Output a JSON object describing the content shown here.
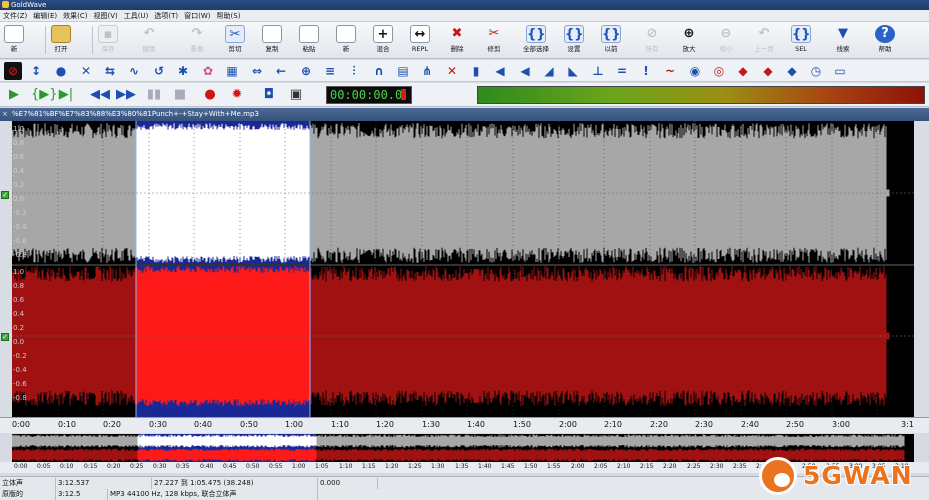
{
  "window": {
    "title": "GoldWave"
  },
  "menu": [
    "文件(Z)",
    "编辑(E)",
    "效果(C)",
    "视图(V)",
    "工具(U)",
    "选项(T)",
    "窗口(W)",
    "帮助(S)"
  ],
  "toolbar_main": [
    {
      "label": "新",
      "icon": "new-file-icon",
      "enabled": true
    },
    {
      "label": "打开",
      "icon": "folder-open-icon",
      "enabled": true
    },
    {
      "label": "保存",
      "icon": "save-icon",
      "enabled": false
    },
    {
      "label": "撤销",
      "icon": "undo-icon",
      "enabled": false
    },
    {
      "label": "重做",
      "icon": "redo-icon",
      "enabled": false
    },
    {
      "label": "剪切",
      "icon": "scissors-icon",
      "enabled": true
    },
    {
      "label": "复制",
      "icon": "copy-icon",
      "enabled": true
    },
    {
      "label": "粘贴",
      "icon": "paste-icon",
      "enabled": true
    },
    {
      "label": "新",
      "icon": "paste-new-icon",
      "enabled": true
    },
    {
      "label": "混合",
      "icon": "mix-icon",
      "enabled": true
    },
    {
      "label": "REPL",
      "icon": "replace-icon",
      "enabled": true
    },
    {
      "label": "删除",
      "icon": "delete-icon",
      "enabled": true
    },
    {
      "label": "修剪",
      "icon": "trim-icon",
      "enabled": true
    },
    {
      "label": "全部选择",
      "icon": "select-all-icon",
      "enabled": true
    },
    {
      "label": "设置",
      "icon": "set-marker-icon",
      "enabled": true
    },
    {
      "label": "以前",
      "icon": "previous-icon",
      "enabled": true
    },
    {
      "label": "所有",
      "icon": "zoom-all-icon",
      "enabled": false
    },
    {
      "label": "放大",
      "icon": "zoom-in-icon",
      "enabled": true
    },
    {
      "label": "缩小",
      "icon": "zoom-out-icon",
      "enabled": false
    },
    {
      "label": "上一页",
      "icon": "previous-page-icon",
      "enabled": false
    },
    {
      "label": "SEL",
      "icon": "zoom-selection-icon",
      "enabled": true
    },
    {
      "label": "线索",
      "icon": "cue-icon",
      "enabled": true
    },
    {
      "label": "帮助",
      "icon": "help-icon",
      "enabled": true
    }
  ],
  "transport": {
    "time": "00:00:00.0"
  },
  "file": {
    "name": "%E7%81%BF%E7%83%88%E3%80%81Punch+-+Stay+With+Me.mp3"
  },
  "amplitude_labels": [
    "1.0",
    "0.8",
    "0.6",
    "0.4",
    "0.2",
    "0.0",
    "-0.2",
    "-0.4",
    "-0.6",
    "-0.8"
  ],
  "time_ticks": [
    "0:00",
    "0:10",
    "0:20",
    "0:30",
    "0:40",
    "0:50",
    "1:00",
    "1:10",
    "1:20",
    "1:30",
    "1:40",
    "1:50",
    "2:00",
    "2:10",
    "2:20",
    "2:30",
    "2:40",
    "2:50",
    "3:00",
    "3:1"
  ],
  "overview_ticks": [
    "0:00",
    "0:05",
    "0:10",
    "0:15",
    "0:20",
    "0:25",
    "0:30",
    "0:35",
    "0:40",
    "0:45",
    "0:50",
    "0:55",
    "1:00",
    "1:05",
    "1:10",
    "1:15",
    "1:20",
    "1:25",
    "1:30",
    "1:35",
    "1:40",
    "1:45",
    "1:50",
    "1:55",
    "2:00",
    "2:05",
    "2:10",
    "2:15",
    "2:20",
    "2:25",
    "2:30",
    "2:35",
    "2:40",
    "2:45",
    "2:50",
    "2:55",
    "3:00",
    "3:05",
    "3:10"
  ],
  "selection": {
    "start_sec": 27.227,
    "end_sec": 65.475,
    "duration_sec": 192.537
  },
  "status": {
    "channel": "立体声",
    "duration": "3:12.537",
    "selection": "27.227 到 1:05.475 (38.248)",
    "mode": "原版的",
    "position": "3:12.5",
    "format": "MP3 44100 Hz, 128 kbps, 联合立体声",
    "zoom": "0.000"
  },
  "watermark": {
    "text": "5GWAN"
  },
  "colors": {
    "left_channel": "#a7a7a7",
    "right_channel": "#a01212",
    "selection_bg": "#1a2896",
    "selection_left": "#ffffff",
    "selection_right": "#ff1a1a",
    "time_display": "#4dd14d"
  }
}
